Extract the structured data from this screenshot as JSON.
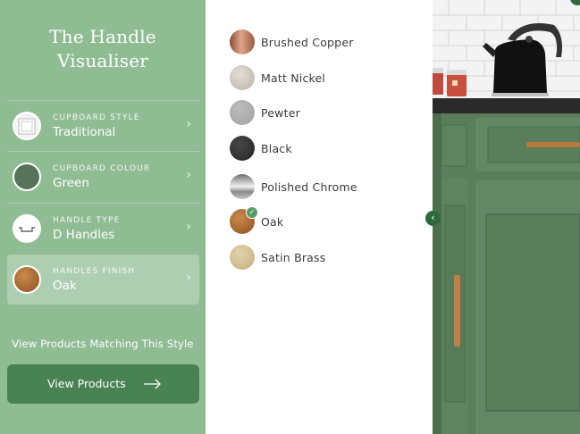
{
  "sidebar": {
    "title_line1": "The Handle",
    "title_line2": "Visualiser",
    "items": [
      {
        "label": "Cupboard Style",
        "value": "Traditional"
      },
      {
        "label": "Cupboard Colour",
        "value": "Green"
      },
      {
        "label": "Handle Type",
        "value": "D Handles"
      },
      {
        "label": "Handles Finish",
        "value": "Oak"
      }
    ],
    "match_link": "View Products Matching This Style",
    "view_button": "View Products"
  },
  "finishes": [
    {
      "label": "Brushed Copper",
      "color": "#b06a4f"
    },
    {
      "label": "Matt Nickel",
      "color": "#cfc8be"
    },
    {
      "label": "Pewter",
      "color": "#a9a9a9"
    },
    {
      "label": "Black",
      "color": "#2e2e2e"
    },
    {
      "label": "Polished Chrome",
      "color": "#9e9e9e"
    },
    {
      "label": "Oak",
      "color": "#a8672c",
      "selected": true
    },
    {
      "label": "Satin Brass",
      "color": "#d1bd93"
    }
  ],
  "colors": {
    "sidebar_bg": "#8fbc93",
    "button_bg": "#4a8353",
    "cabinet_green": "#5a7e5c",
    "selected_check": "#5a9a6c"
  }
}
